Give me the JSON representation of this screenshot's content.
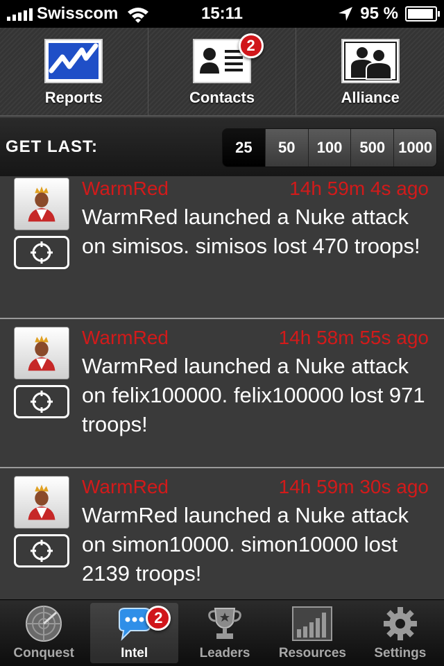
{
  "status_bar": {
    "carrier": "Swisscom",
    "time": "15:11",
    "battery": "95 %",
    "battery_level": 0.95,
    "signal_bars": 5
  },
  "top_nav": {
    "items": [
      {
        "label": "Reports",
        "icon": "chart-icon"
      },
      {
        "label": "Contacts",
        "icon": "contact-card-icon",
        "badge": "2"
      },
      {
        "label": "Alliance",
        "icon": "group-icon"
      }
    ]
  },
  "filter": {
    "label": "GET LAST:",
    "options": [
      "25",
      "50",
      "100",
      "500",
      "1000"
    ],
    "selected": "25"
  },
  "feed": {
    "items": [
      {
        "author": "WarmRed",
        "time": "14h 59m 4s ago",
        "message": "WarmRed launched a Nuke attack on simisos. simisos lost 470 troops!"
      },
      {
        "author": "WarmRed",
        "time": "14h 58m 55s ago",
        "message": "WarmRed launched a Nuke attack on felix100000. felix100000 lost 971 troops!"
      },
      {
        "author": "WarmRed",
        "time": "14h 59m 30s ago",
        "message": "WarmRed launched a Nuke attack on simon10000. simon10000 lost 2139 troops!"
      }
    ]
  },
  "tab_bar": {
    "tabs": [
      {
        "label": "Conquest",
        "icon": "radar-icon"
      },
      {
        "label": "Intel",
        "icon": "chat-bubble-icon",
        "badge": "2",
        "active": true
      },
      {
        "label": "Leaders",
        "icon": "trophy-icon"
      },
      {
        "label": "Resources",
        "icon": "bar-chart-icon"
      },
      {
        "label": "Settings",
        "icon": "gear-icon"
      }
    ]
  },
  "colors": {
    "accent_red": "#d21a1a",
    "badge_red": "#d0161b",
    "chart_blue": "#1f4fc7"
  }
}
